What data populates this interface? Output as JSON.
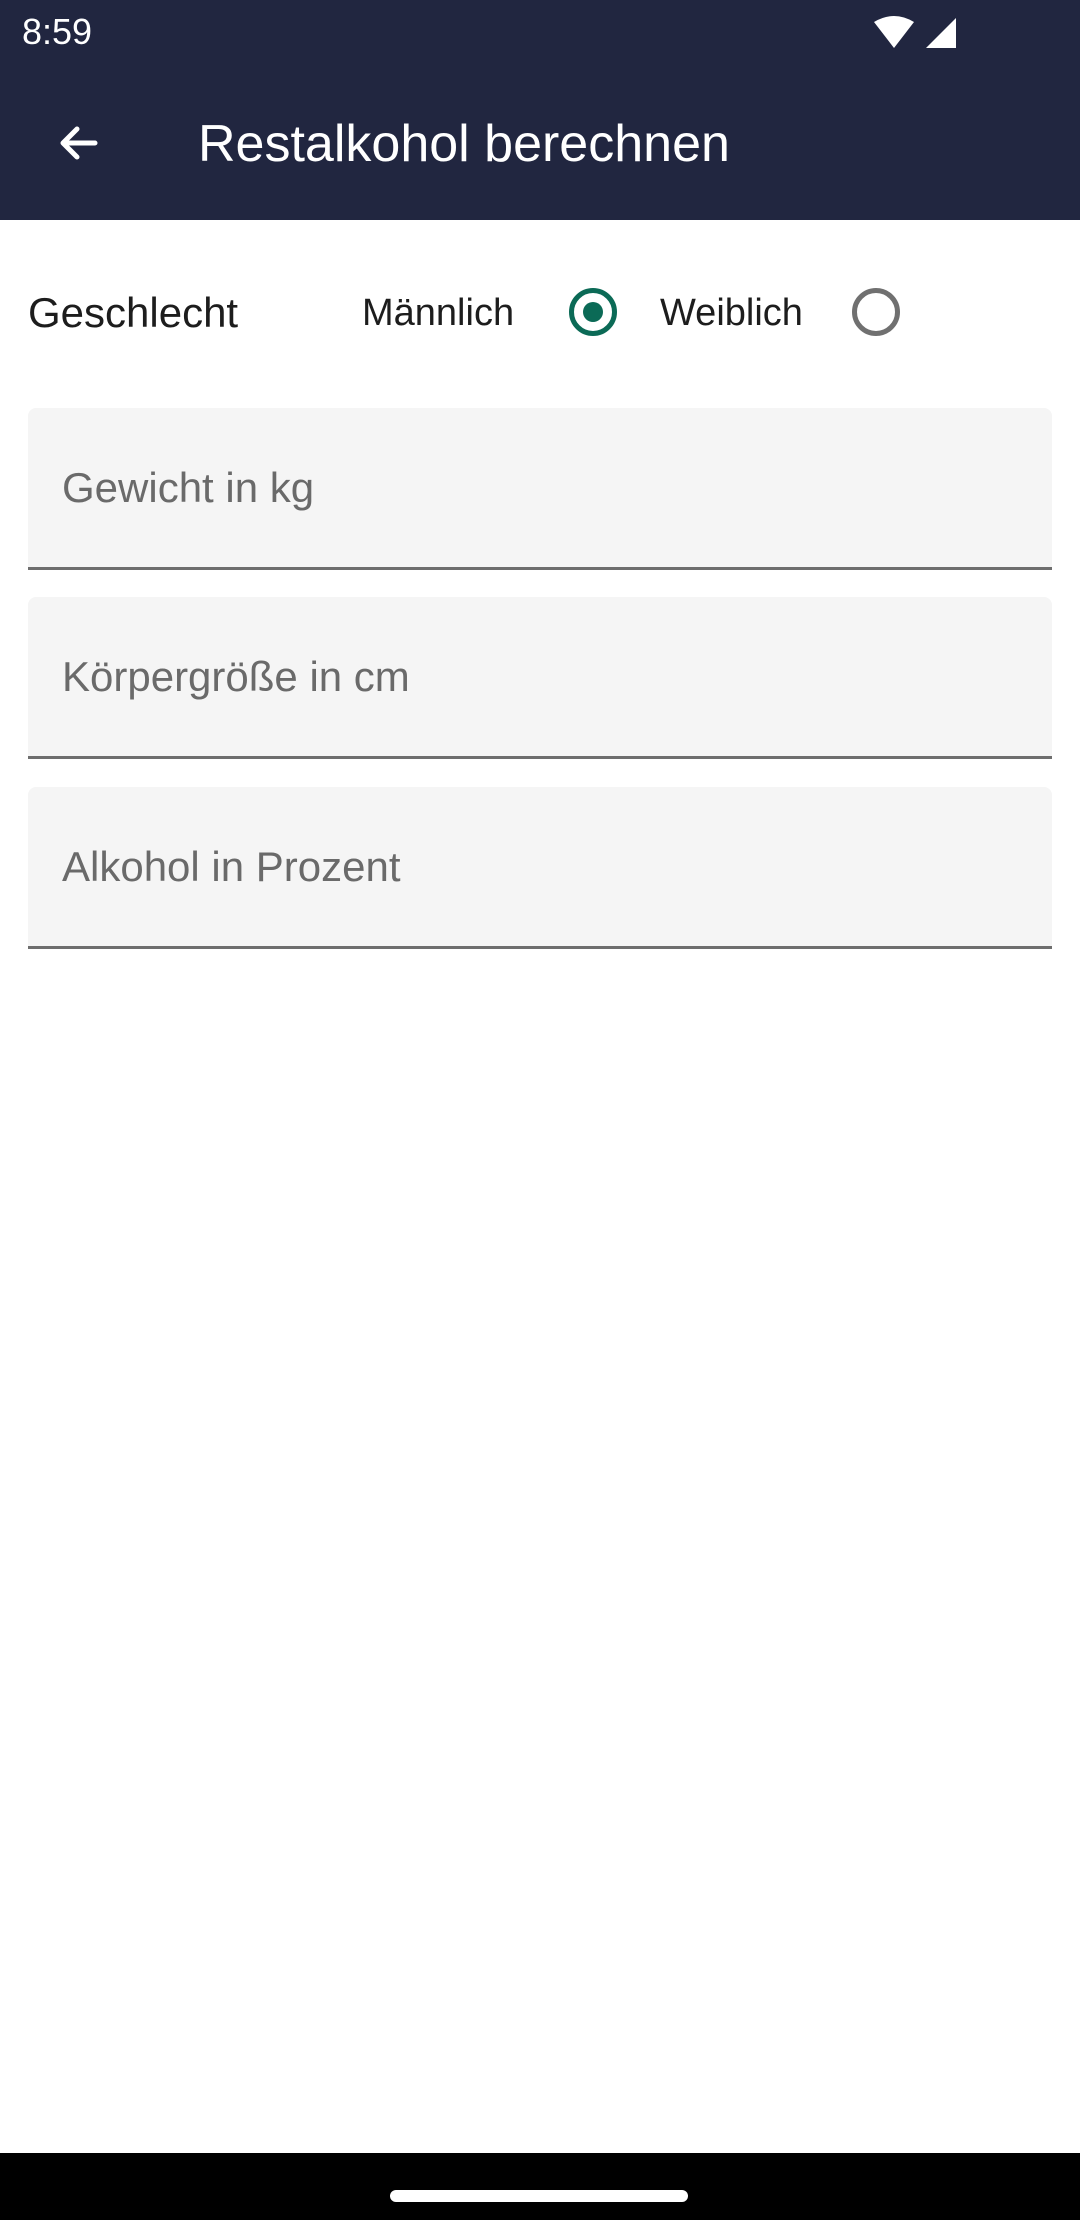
{
  "status_bar": {
    "time": "8:59",
    "icons": [
      "wifi-icon",
      "cell-signal-icon"
    ]
  },
  "app_bar": {
    "back_icon": "arrow-left-icon",
    "title": "Restalkohol berechnen"
  },
  "gender": {
    "label": "Geschlecht",
    "options": [
      {
        "label": "Männlich",
        "selected": true
      },
      {
        "label": "Weiblich",
        "selected": false
      }
    ]
  },
  "fields": [
    {
      "placeholder": "Gewicht in kg",
      "value": ""
    },
    {
      "placeholder": "Körpergröße in cm",
      "value": ""
    },
    {
      "placeholder": "Alkohol in Prozent",
      "value": ""
    }
  ],
  "colors": {
    "app_bar": "#212640",
    "accent": "#0b6a56",
    "field_background": "#f5f5f5"
  }
}
